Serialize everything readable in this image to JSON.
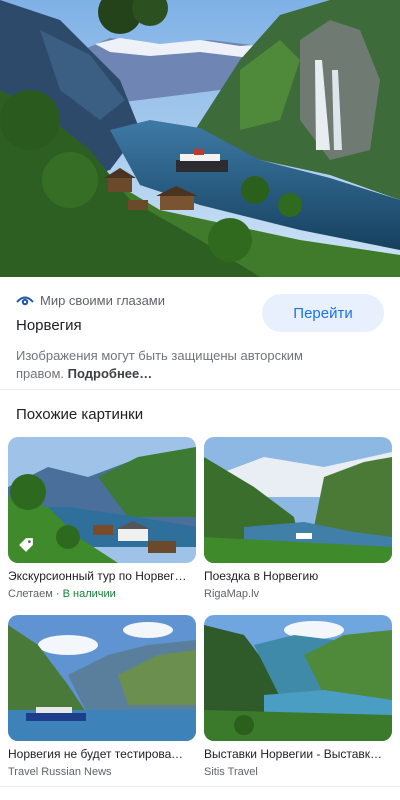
{
  "source": {
    "site_name": "Мир своими глазами",
    "title": "Норвегия",
    "visit_label": "Перейти",
    "copyright_text": "Изображения могут быть защищены авторским правом.",
    "more_label": "Подробнее…"
  },
  "related": {
    "heading": "Похожие картинки",
    "items": [
      {
        "caption": "Экскурсионный тур по Норвег…",
        "source": "Слетаем",
        "extra": " · В наличии"
      },
      {
        "caption": "Поездка в Норвегию",
        "source": "RigaMap.lv",
        "extra": ""
      },
      {
        "caption": "Норвегия не будет тестироват…",
        "source": "Travel Russian News",
        "extra": ""
      },
      {
        "caption": "Выставки Норвегии - Выставк…",
        "source": "Sitis Travel",
        "extra": ""
      }
    ]
  },
  "colors": {
    "accent": "#1a73e8",
    "button_bg": "#e8f0fe",
    "in_stock": "#188038"
  },
  "icons": [
    "site-eye-icon",
    "price-tag-icon"
  ]
}
